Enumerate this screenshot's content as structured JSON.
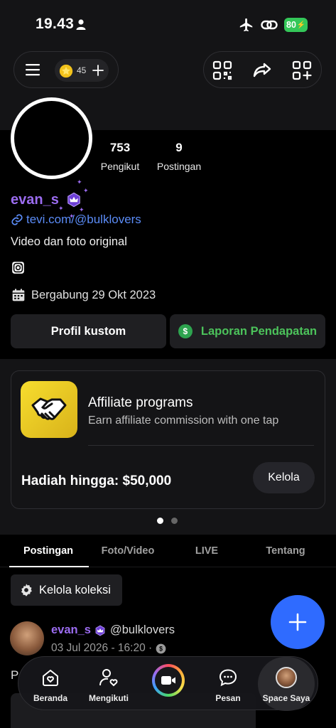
{
  "status_bar": {
    "time": "19.43",
    "battery": "80"
  },
  "header": {
    "coins": "45"
  },
  "profile": {
    "followers_count": "753",
    "followers_label": "Pengikut",
    "posts_count": "9",
    "posts_label": "Postingan",
    "username": "evan_s",
    "link": "tevi.com/@bulklovers",
    "bio": "Video dan foto original",
    "joined": "Bergabung 29 Okt 2023"
  },
  "buttons": {
    "custom_profile": "Profil kustom",
    "earnings_report": "Laporan Pendapatan"
  },
  "affiliate": {
    "title": "Affiliate programs",
    "subtitle": "Earn affiliate commission with one tap",
    "reward": "Hadiah hingga: $50,000",
    "manage": "Kelola"
  },
  "tabs": [
    {
      "label": "Postingan"
    },
    {
      "label": "Foto/Video"
    },
    {
      "label": "LIVE"
    },
    {
      "label": "Tentang"
    }
  ],
  "collection": {
    "label": "Kelola koleksi"
  },
  "post": {
    "username": "evan_s",
    "handle": "@bulklovers",
    "date": "03 Jul 2026 - 16:20 ·",
    "text_start": "P"
  },
  "nav": {
    "home": "Beranda",
    "following": "Mengikuti",
    "messages": "Pesan",
    "space": "Space Saya"
  },
  "colors": {
    "accent_purple": "#9b6cf0",
    "link_blue": "#5b8cf7",
    "earnings_green": "#4cc35b",
    "fab_blue": "#2f6bff"
  }
}
